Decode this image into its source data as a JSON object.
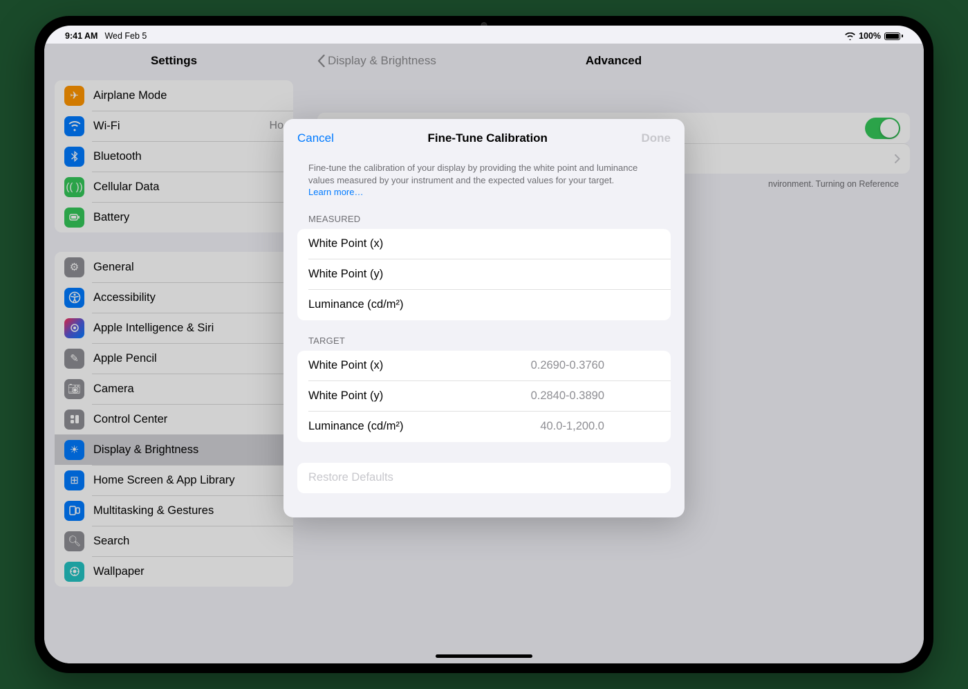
{
  "status": {
    "time": "9:41 AM",
    "date": "Wed Feb 5",
    "battery": "100%"
  },
  "sidebar": {
    "title": "Settings",
    "g1": [
      {
        "icon": "✈︎",
        "bg": "#ff9500",
        "label": "Airplane Mode"
      },
      {
        "icon": "wifi",
        "bg": "#007aff",
        "label": "Wi-Fi",
        "value": "Ho"
      },
      {
        "icon": "bt",
        "bg": "#007aff",
        "label": "Bluetooth"
      },
      {
        "icon": "(( ))",
        "bg": "#34c759",
        "label": "Cellular Data"
      },
      {
        "icon": "batt",
        "bg": "#34c759",
        "label": "Battery"
      }
    ],
    "g2": [
      {
        "icon": "⚙",
        "bg": "#8e8e93",
        "label": "General"
      },
      {
        "icon": "acc",
        "bg": "#007aff",
        "label": "Accessibility"
      },
      {
        "icon": "ai",
        "bg": "grad",
        "label": "Apple Intelligence & Siri"
      },
      {
        "icon": "✎",
        "bg": "#8e8e93",
        "label": "Apple Pencil"
      },
      {
        "icon": "📷︎",
        "bg": "#8e8e93",
        "label": "Camera"
      },
      {
        "icon": "cc",
        "bg": "#8e8e93",
        "label": "Control Center"
      },
      {
        "icon": "☀",
        "bg": "#007aff",
        "label": "Display & Brightness",
        "sel": true
      },
      {
        "icon": "⊞",
        "bg": "#007aff",
        "label": "Home Screen & App Library"
      },
      {
        "icon": "mt",
        "bg": "#007aff",
        "label": "Multitasking & Gestures"
      },
      {
        "icon": "🔍︎",
        "bg": "#8e8e93",
        "label": "Search"
      },
      {
        "icon": "wp",
        "bg": "#23c2c2",
        "label": "Wallpaper"
      }
    ]
  },
  "main": {
    "back": "Display & Brightness",
    "title": "Advanced",
    "footer": "nvironment. Turning on Reference"
  },
  "modal": {
    "cancel": "Cancel",
    "title": "Fine-Tune Calibration",
    "done": "Done",
    "desc": "Fine-tune the calibration of your display by providing the white point and luminance values measured by your instrument and the expected values for your target.",
    "learn": "Learn more…",
    "measured_label": "Measured",
    "measured": [
      {
        "k": "White Point (x)"
      },
      {
        "k": "White Point (y)"
      },
      {
        "k": "Luminance (cd/m²)"
      }
    ],
    "target_label": "Target",
    "target": [
      {
        "k": "White Point (x)",
        "v": "0.2690-0.3760"
      },
      {
        "k": "White Point (y)",
        "v": "0.2840-0.3890"
      },
      {
        "k": "Luminance (cd/m²)",
        "v": "40.0-1,200.0"
      }
    ],
    "restore": "Restore Defaults"
  }
}
